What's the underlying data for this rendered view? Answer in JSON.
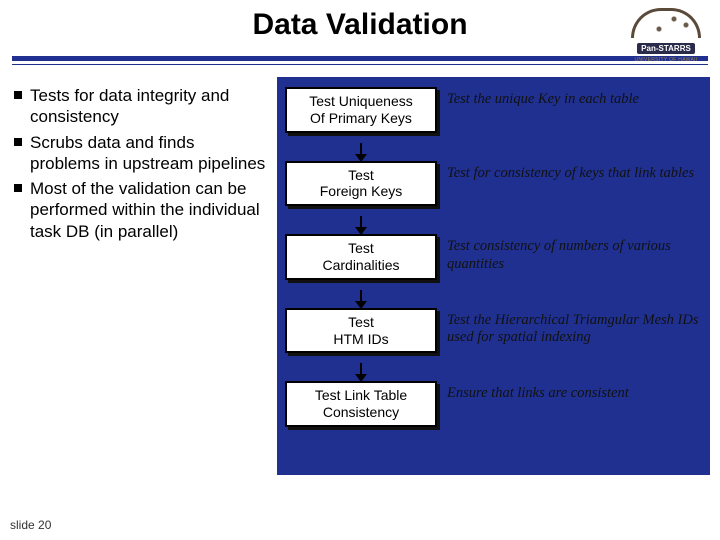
{
  "title": "Data Validation",
  "logo": {
    "brand": "Pan-STARRS",
    "sub": "UNIVERSITY OF HAWAII"
  },
  "bullets": [
    "Tests for data integrity and consistency",
    "Scrubs data and finds problems in upstream pipelines",
    "Most of the validation can be performed within the individual task DB (in parallel)"
  ],
  "steps": [
    {
      "label": "Test Uniqueness\nOf Primary Keys",
      "desc": "Test the unique Key in each table"
    },
    {
      "label": "Test\nForeign Keys",
      "desc": "Test for consistency of keys that link tables"
    },
    {
      "label": "Test\nCardinalities",
      "desc": "Test consistency of numbers of various quantities"
    },
    {
      "label": "Test\nHTM IDs",
      "desc": "Test the Hierarchical Triamgular Mesh IDs used for spatial indexing"
    },
    {
      "label": "Test Link Table\nConsistency",
      "desc": "Ensure that links are consistent"
    }
  ],
  "footer": "slide 20"
}
